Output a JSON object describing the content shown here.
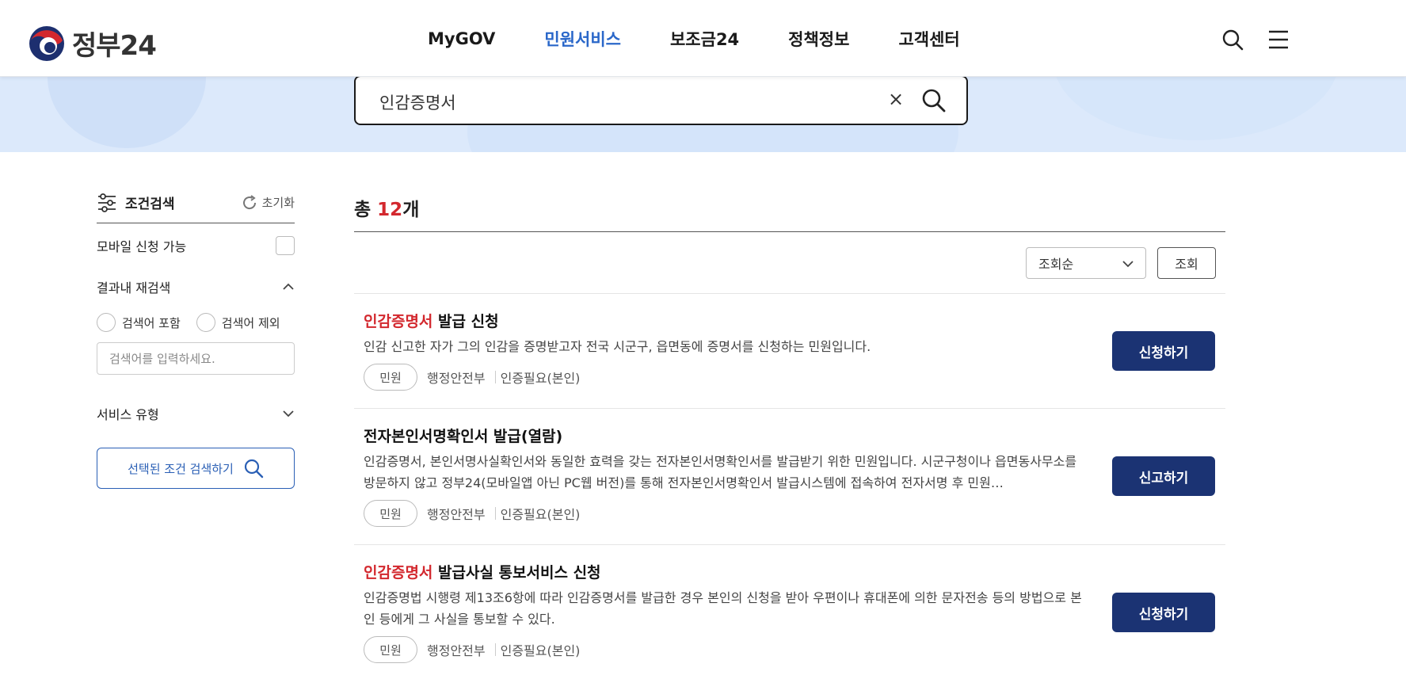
{
  "header": {
    "logo_text": "정부24",
    "nav": [
      {
        "label": "MyGOV",
        "active": false
      },
      {
        "label": "민원서비스",
        "active": true
      },
      {
        "label": "보조금24",
        "active": false
      },
      {
        "label": "정책정보",
        "active": false
      },
      {
        "label": "고객센터",
        "active": false
      }
    ],
    "icons": [
      "search-icon",
      "menu-icon"
    ]
  },
  "search": {
    "value": "인감증명서",
    "clear_label": "×"
  },
  "sidebar": {
    "title": "조건검색",
    "reset_label": "초기화",
    "mobile_label": "모바일 신청 가능",
    "refine_label": "결과내 재검색",
    "radio_include": "검색어 포함",
    "radio_exclude": "검색어 제외",
    "refine_placeholder": "검색어를 입력하세요.",
    "service_type_label": "서비스 유형",
    "search_button": "선택된 조건 검색하기"
  },
  "results_header": {
    "total_prefix": "총 ",
    "total_count": "12",
    "total_suffix": "개",
    "sort_selected": "조회순",
    "view_button": "조회"
  },
  "results": [
    {
      "title_highlight": "인감증명서",
      "title_rest": " 발급 신청",
      "description": "인감 신고한 자가 그의 인감을 증명받고자 전국 시군구, 읍면동에 증명서를 신청하는 민원입니다.",
      "tag": "민원",
      "agency": "행정안전부",
      "auth": "인증필요(본인)",
      "button": "신청하기"
    },
    {
      "title_highlight": "",
      "title_rest": "전자본인서명확인서 발급(열람)",
      "description": "인감증명서, 본인서명사실확인서와 동일한 효력을 갖는 전자본인서명확인서를 발급받기 위한 민원입니다. 시군구청이나 읍면동사무소를 방문하지 않고 정부24(모바일앱 아닌 PC웹 버전)를 통해 전자본인서명확인서 발급시스템에 접속하여 전자서명 후 민원…",
      "tag": "민원",
      "agency": "행정안전부",
      "auth": "인증필요(본인)",
      "button": "신고하기"
    },
    {
      "title_highlight": "인감증명서",
      "title_rest": " 발급사실 통보서비스 신청",
      "description": "인감증명법 시행령 제13조6항에 따라 인감증명서를 발급한 경우 본인의 신청을 받아 우편이나 휴대폰에 의한 문자전송 등의 방법으로 본인 등에게 그 사실을 통보할 수 있다.",
      "tag": "민원",
      "agency": "행정안전부",
      "auth": "인증필요(본인)",
      "button": "신청하기"
    }
  ],
  "colors": {
    "accent_blue": "#2a67c9",
    "highlight_red": "#d3282e",
    "button_navy": "#1b3373",
    "banner_bg": "#dce9fb"
  }
}
